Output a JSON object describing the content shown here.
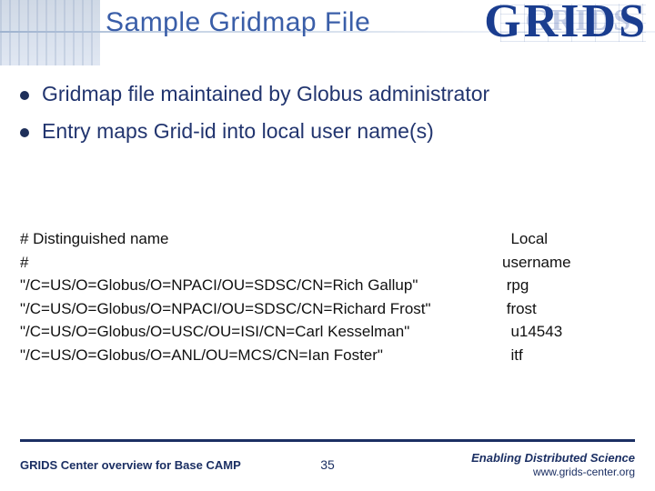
{
  "header": {
    "title": "Sample Gridmap File",
    "logo_text": "GRIDS",
    "logo_shadow": "GRIDS"
  },
  "bullets": [
    "Gridmap file maintained by Globus administrator",
    "Entry maps Grid-id into local user name(s)"
  ],
  "gridmap": {
    "header_dn": "# Distinguished name",
    "header_local_1": "  Local",
    "hash_only": "#",
    "header_local_2": "username",
    "rows": [
      {
        "dn": "\"/C=US/O=Globus/O=NPACI/OU=SDSC/CN=Rich Gallup\"",
        "local": " rpg"
      },
      {
        "dn": "\"/C=US/O=Globus/O=NPACI/OU=SDSC/CN=Richard Frost\"",
        "local": " frost"
      },
      {
        "dn": "\"/C=US/O=Globus/O=USC/OU=ISI/CN=Carl Kesselman\"",
        "local": "  u14543"
      },
      {
        "dn": "\"/C=US/O=Globus/O=ANL/OU=MCS/CN=Ian Foster\"",
        "local": "  itf"
      }
    ]
  },
  "footer": {
    "left": "GRIDS Center overview for Base CAMP",
    "center": "35",
    "right_tag": "Enabling Distributed Science",
    "right_url": "www.grids-center.org"
  }
}
